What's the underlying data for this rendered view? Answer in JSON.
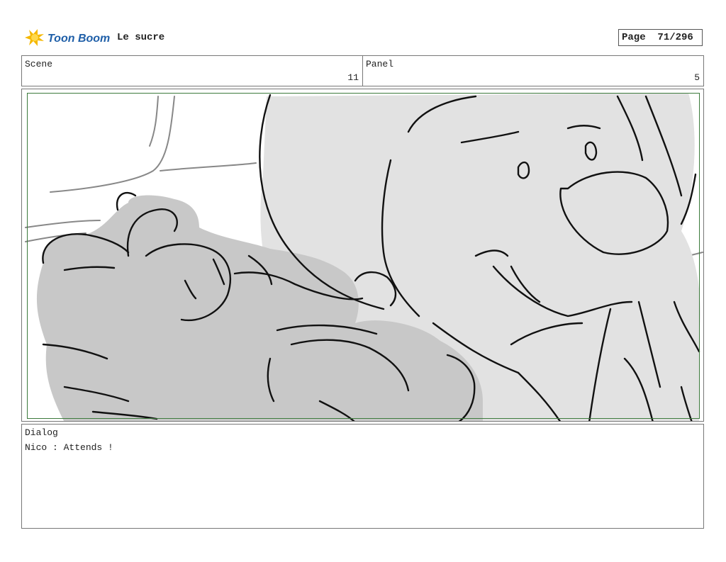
{
  "header": {
    "logo_text": "Toon Boom",
    "project_title": "Le sucre",
    "page_label": "Page",
    "page_value": "71/296"
  },
  "scene": {
    "label": "Scene",
    "value": "11"
  },
  "panel": {
    "label": "Panel",
    "value": "5"
  },
  "dialog": {
    "label": "Dialog",
    "text": "Nico : Attends !"
  },
  "colors": {
    "safe_frame": "#3c7a3c",
    "sketch_light_fill": "#e2e2e2",
    "sketch_dark_fill": "#c8c8c8",
    "logo_yellow": "#f5b800",
    "logo_blue": "#1f5fa8"
  }
}
